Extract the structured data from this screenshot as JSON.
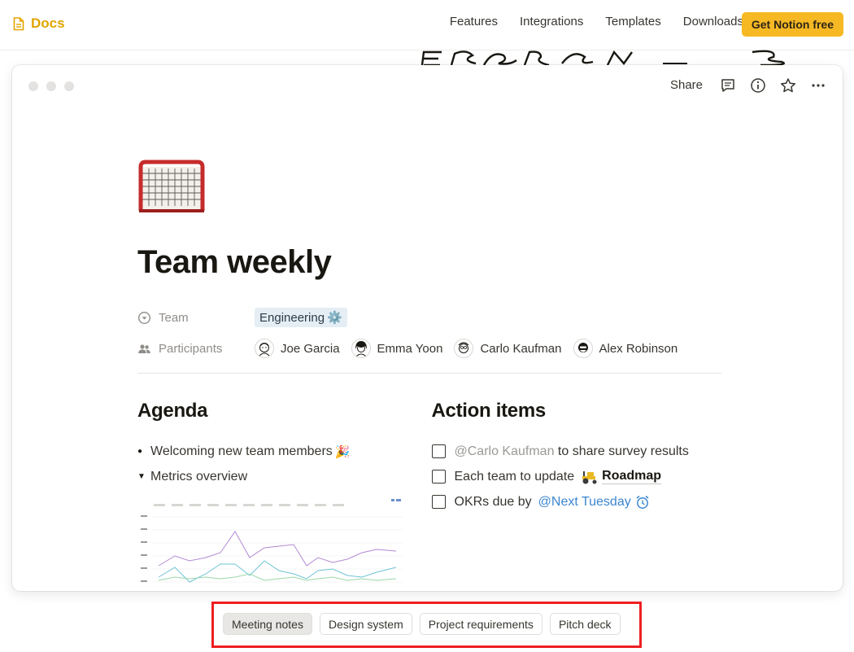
{
  "nav": {
    "brand": "Docs",
    "links": [
      "Features",
      "Integrations",
      "Templates",
      "Downloads"
    ],
    "cta": "Get Notion free"
  },
  "card": {
    "actions": {
      "share": "Share"
    }
  },
  "page": {
    "icon": "hockey-goal-icon",
    "title": "Team weekly",
    "properties": {
      "team_label": "Team",
      "team_value": "Engineering",
      "team_emoji": "⚙️",
      "participants_label": "Participants",
      "participants": [
        "Joe Garcia",
        "Emma Yoon",
        "Carlo Kaufman",
        "Alex Robinson"
      ]
    },
    "agenda": {
      "heading": "Agenda",
      "items": [
        {
          "text": "Welcoming new team members",
          "emoji": "🎉"
        },
        {
          "text": "Metrics overview"
        }
      ]
    },
    "action_items": {
      "heading": "Action items",
      "items": [
        {
          "mention": "@Carlo Kaufman",
          "text": " to share survey results"
        },
        {
          "text": "Each team to update",
          "link": "Roadmap"
        },
        {
          "text": "OKRs due by",
          "date_mention": "@Next Tuesday"
        }
      ]
    }
  },
  "tabs": [
    {
      "label": "Meeting notes",
      "active": true
    },
    {
      "label": "Design system",
      "active": false
    },
    {
      "label": "Project requirements",
      "active": false
    },
    {
      "label": "Pitch deck",
      "active": false
    }
  ],
  "colors": {
    "brand": "#e2a400",
    "cta_bg": "#f6b923",
    "highlight": "#ee1f22",
    "mention_blue": "#3b86d1",
    "tag_bg": "#e4eef4"
  }
}
